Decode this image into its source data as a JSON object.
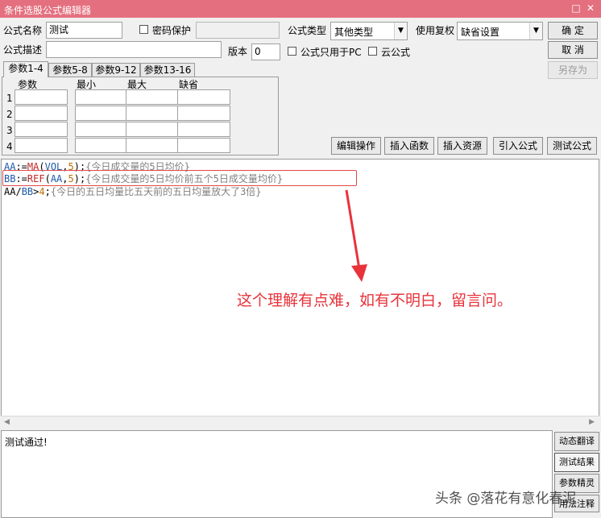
{
  "window": {
    "title": "条件选股公式编辑器",
    "minimize_glyph": "□",
    "close_glyph": "✕"
  },
  "form": {
    "name_label": "公式名称",
    "name_value": "测试",
    "password_label": "密码保护",
    "type_label": "公式类型",
    "type_value": "其他类型",
    "rights_label": "使用复权",
    "rights_value": "缺省设置",
    "desc_label": "公式描述",
    "desc_value": "",
    "version_label": "版本",
    "version_value": "0",
    "pc_only_label": "公式只用于PC",
    "cloud_label": "云公式"
  },
  "buttons": {
    "ok": "确  定",
    "cancel": "取  消",
    "save_as": "另存为",
    "edit_ops": "编辑操作",
    "insert_func": "插入函数",
    "insert_res": "插入资源",
    "import_formula": "引入公式",
    "test_formula": "测试公式"
  },
  "tabs": [
    "参数1-4",
    "参数5-8",
    "参数9-12",
    "参数13-16"
  ],
  "params": {
    "headers": [
      "参数",
      "最小",
      "最大",
      "缺省"
    ],
    "rows": [
      "1",
      "2",
      "3",
      "4"
    ]
  },
  "code": {
    "line1": {
      "var": "AA",
      "op": ":=",
      "fn": "MA",
      "open": "(",
      "arg": "VOL",
      "comma": ",",
      "num": "5",
      "close": ");",
      "comment": "{今日成交量的5日均价}"
    },
    "line2": {
      "var": "BB",
      "op": ":=",
      "fn": "REF",
      "open": "(",
      "arg": "AA",
      "comma": ",",
      "num": "5",
      "close": ");",
      "comment": "{今日成交量的5日均价前五个5日成交量均价}"
    },
    "line3": {
      "var1": "AA",
      "slash": "/",
      "var2": "BB",
      "op": ">",
      "num": "4",
      "semi": ";",
      "comment": "{今日的五日均量比五天前的五日均量放大了3倍}"
    }
  },
  "annotation": "这个理解有点难，如有不明白，留言问。",
  "output": {
    "text": "测试通过!"
  },
  "side_buttons": [
    "动态翻译",
    "测试结果",
    "参数精灵",
    "用法注释"
  ],
  "watermark": "头条 @落花有意化春泥",
  "colors": {
    "titlebar": "#e4707f",
    "annotation": "#e8333b",
    "highlight_box": "#e0484a"
  }
}
